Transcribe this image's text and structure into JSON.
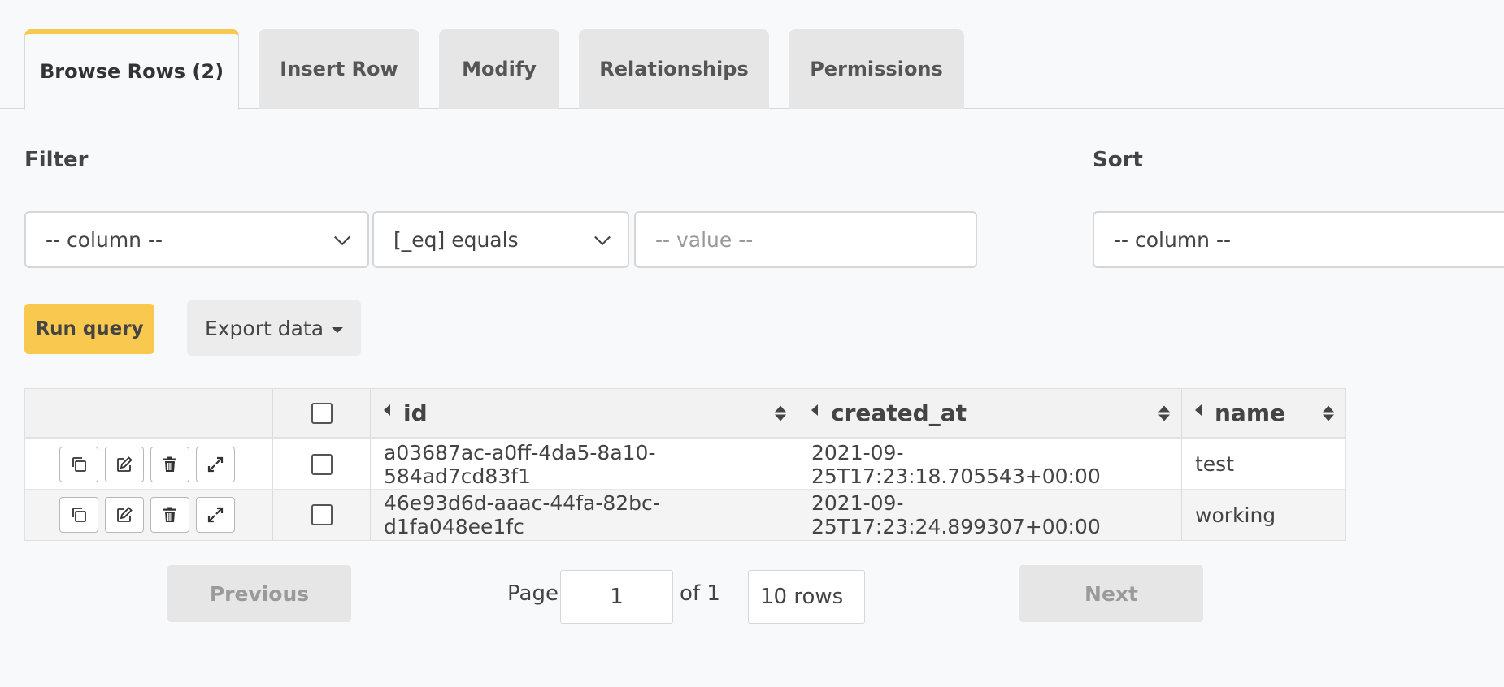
{
  "tabs": [
    {
      "label": "Browse Rows (2)",
      "active": true
    },
    {
      "label": "Insert Row",
      "active": false
    },
    {
      "label": "Modify",
      "active": false
    },
    {
      "label": "Relationships",
      "active": false
    },
    {
      "label": "Permissions",
      "active": false
    }
  ],
  "filter": {
    "title": "Filter",
    "column_value": "-- column --",
    "operator_value": "[_eq] equals",
    "value_placeholder": "-- value --"
  },
  "sort": {
    "title": "Sort",
    "column_value": "-- column --"
  },
  "actions": {
    "run_query_label": "Run query",
    "export_label": "Export data"
  },
  "table": {
    "columns": [
      "id",
      "created_at",
      "name"
    ],
    "rows": [
      {
        "id": "a03687ac-a0ff-4da5-8a10-584ad7cd83f1",
        "created_at": "2021-09-25T17:23:18.705543+00:00",
        "name": "test"
      },
      {
        "id": "46e93d6d-aaac-44fa-82bc-d1fa048ee1fc",
        "created_at": "2021-09-25T17:23:24.899307+00:00",
        "name": "working"
      }
    ],
    "row_action_icons": [
      "clone-icon",
      "edit-icon",
      "delete-icon",
      "expand-icon"
    ]
  },
  "pagination": {
    "previous_label": "Previous",
    "page_label": "Page",
    "page_value": "1",
    "of_label": "of 1",
    "rows_value": "10 rows",
    "next_label": "Next"
  },
  "colors": {
    "accent": "#f8c84f",
    "background": "#f8f9fb",
    "tab_inactive": "#e6e6e6"
  }
}
